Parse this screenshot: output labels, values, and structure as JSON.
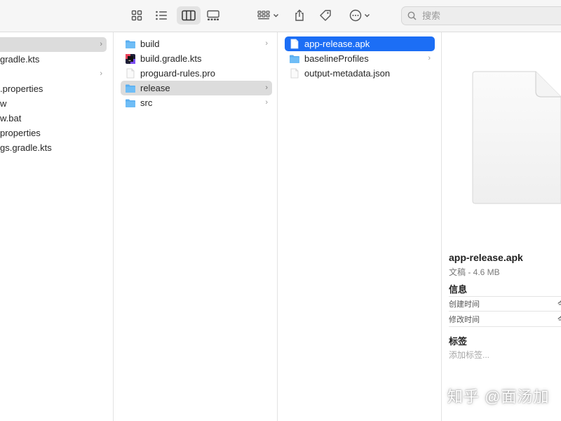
{
  "search": {
    "placeholder": "搜索"
  },
  "column1": {
    "items": [
      {
        "label": "",
        "selected": true
      },
      {
        "label": "gradle.kts"
      },
      {
        "label": ""
      },
      {
        "label": ".properties"
      },
      {
        "label": "w"
      },
      {
        "label": "w.bat"
      },
      {
        "label": "properties"
      },
      {
        "label": "gs.gradle.kts"
      }
    ]
  },
  "column2": {
    "items": [
      {
        "label": "build",
        "type": "folder"
      },
      {
        "label": "build.gradle.kts",
        "type": "kotlin-file"
      },
      {
        "label": "proguard-rules.pro",
        "type": "file"
      },
      {
        "label": "release",
        "type": "folder",
        "selected": true
      },
      {
        "label": "src",
        "type": "folder"
      }
    ]
  },
  "column3": {
    "items": [
      {
        "label": "app-release.apk",
        "type": "file",
        "selected": true
      },
      {
        "label": "baselineProfiles",
        "type": "folder"
      },
      {
        "label": "output-metadata.json",
        "type": "file"
      }
    ]
  },
  "preview": {
    "name": "app-release.apk",
    "meta": "文稿 - 4.6 MB",
    "info_heading": "信息",
    "created_label": "创建时间",
    "created_value": "今",
    "modified_label": "修改时间",
    "modified_value": "今",
    "tags_heading": "标签",
    "add_tag_placeholder": "添加标签..."
  },
  "watermark": "知乎 @面汤加",
  "colors": {
    "accent": "#1c6ef5",
    "folder": "#5aaef0",
    "selection_gray": "#dcdcdc"
  }
}
